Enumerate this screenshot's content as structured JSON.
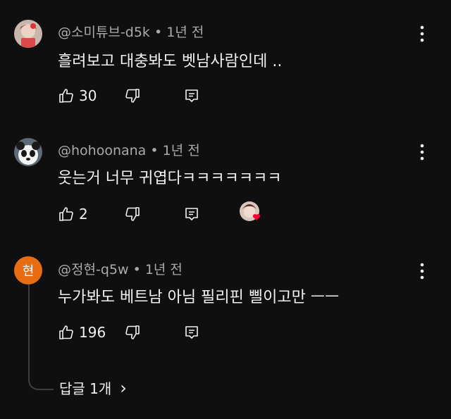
{
  "comments": [
    {
      "handle": "@소미튜브-d5k",
      "time": "1년 전",
      "text": "흘려보고 대충봐도 벳남사람인데 ..",
      "likes": "30"
    },
    {
      "handle": "@hohoonana",
      "time": "1년 전",
      "text": "웃는거 너무 귀엽다ㅋㅋㅋㅋㅋㅋㅋ",
      "likes": "2"
    },
    {
      "handle": "@정현-q5w",
      "time": "1년 전",
      "text": "누가봐도 베트남 아님 필리핀 삘이고만 ㅡㅡ",
      "likes": "196",
      "avatar_letter": "현",
      "avatar_color": "#e66e10"
    }
  ],
  "separator": "•",
  "replies_label": "답글 1개",
  "replies_chevron": "›"
}
